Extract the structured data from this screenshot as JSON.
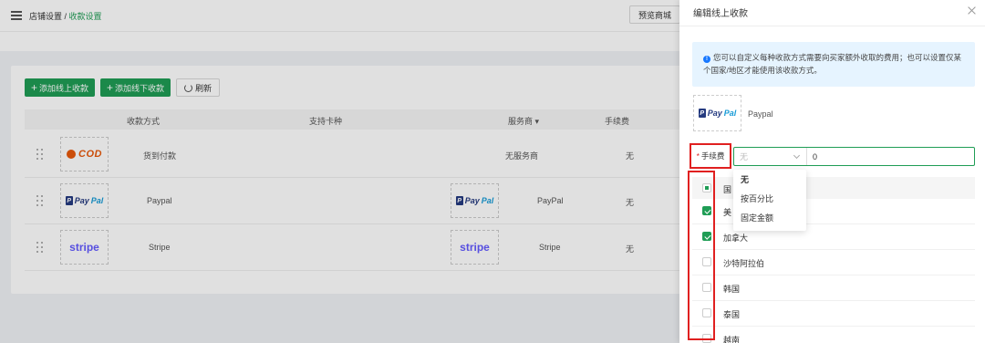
{
  "header": {
    "breadcrumb_root": "店铺设置 /",
    "breadcrumb_current": "收款设置",
    "preview_label": "预览商城"
  },
  "toolbar": {
    "add_online": "添加线上收款",
    "add_offline": "添加线下收款",
    "refresh": "刷新"
  },
  "table": {
    "columns": [
      "收款方式",
      "支持卡种",
      "服务商",
      "手续费"
    ],
    "rows": [
      {
        "logo": "cod",
        "logo_text": "COD",
        "name": "货到付款",
        "provider": "无服务商",
        "provider_logo": "",
        "fee": "无"
      },
      {
        "logo": "paypal",
        "logo_text": "PayPal",
        "name": "Paypal",
        "provider": "PayPal",
        "provider_logo": "paypal",
        "fee": "无"
      },
      {
        "logo": "stripe",
        "logo_text": "stripe",
        "name": "Stripe",
        "provider": "Stripe",
        "provider_logo": "stripe",
        "fee": "无"
      }
    ]
  },
  "drawer": {
    "title": "编辑线上收款",
    "info": "您可以自定义每种收款方式需要向买家额外收取的费用；也可以设置仅某个国家/地区才能使用该收款方式。",
    "method_logo": "PayPal",
    "method_name": "Paypal",
    "fee_label": "手续费",
    "fee_select_value": "无",
    "fee_input_value": "0",
    "dropdown_options": [
      "无",
      "按百分比",
      "固定金额"
    ],
    "countries_header_partial": "国",
    "countries": [
      {
        "name": "美",
        "checked": true
      },
      {
        "name": "加拿大",
        "checked": true
      },
      {
        "name": "沙特阿拉伯",
        "checked": false
      },
      {
        "name": "韩国",
        "checked": false
      },
      {
        "name": "泰国",
        "checked": false
      },
      {
        "name": "越南",
        "checked": false
      }
    ]
  },
  "colors": {
    "primary": "#1f9d55",
    "highlight": "#e02020",
    "info_bg": "#e6f4ff"
  }
}
